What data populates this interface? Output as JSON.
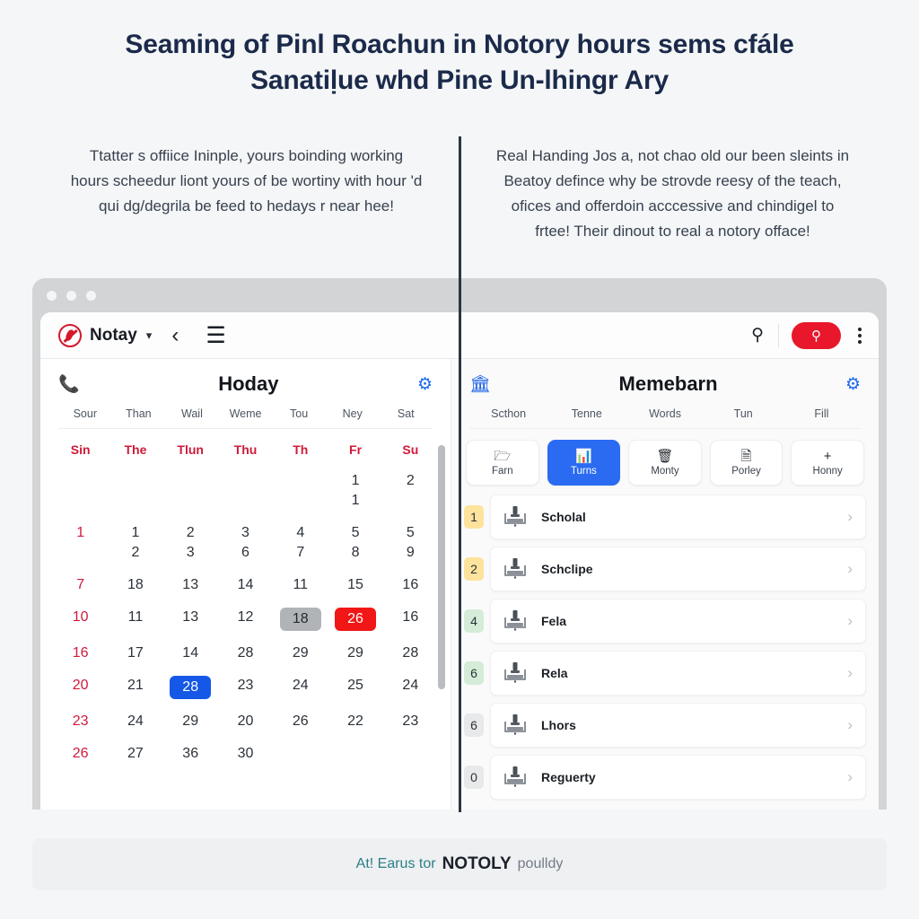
{
  "title": {
    "line1": "Seaming of Pinl Roachun in Notory hours sems cfále",
    "line2": "Sanatiḷue whd Pine Un-lhingr Ary"
  },
  "intro": {
    "left": "Ttatter s offiice Ininple, yours boinding working hours scheedur liont yours of be wortiny with hour 'd qui dg/degrila be feed to hedays r near hee!",
    "right": "Real Handing Jos a, not chao old our been sleints in Beatoy defince why be strovde reesy of the teach, ofices and offerdoin acccessive and chindigel to frtee! Their dinout to real a notory offace!"
  },
  "browser": {
    "toolbar": {
      "brand": "Notay",
      "chevron_icon": "chevron-down-icon",
      "back_icon": "back-arrow-icon",
      "menu_icon": "hamburger-menu-icon",
      "search_icon": "search-icon",
      "search_button_icon": "search-icon",
      "kebab_icon": "more-vertical-icon",
      "accent": "#e8172b"
    },
    "left_panel": {
      "title": "Hoday",
      "left_icon": "phone-icon",
      "gear_icon": "gear-icon",
      "sublabels": [
        "Sour",
        "Than",
        "Wail",
        "Weme",
        "Tou",
        "Ney",
        "Sat"
      ],
      "weekdays": [
        "Sin",
        "The",
        "Tlun",
        "Thu",
        "Th",
        "Fr",
        "Su"
      ],
      "weeks": [
        [
          {
            "text": ""
          },
          {
            "text": ""
          },
          {
            "text": ""
          },
          {
            "text": ""
          },
          {
            "text": ""
          },
          {
            "text": "1",
            "second": "1"
          },
          {
            "text": "2"
          }
        ],
        [
          {
            "text": "1",
            "sunday": true
          },
          {
            "text": "1",
            "second": "2"
          },
          {
            "text": "2",
            "second": "3"
          },
          {
            "text": "3",
            "second": "6"
          },
          {
            "text": "4",
            "second": "7"
          },
          {
            "text": "5",
            "second": "8"
          },
          {
            "text": "5",
            "second": "9"
          }
        ],
        [
          {
            "text": "7",
            "sunday": true
          },
          {
            "text": "18"
          },
          {
            "text": "13"
          },
          {
            "text": "14"
          },
          {
            "text": "11"
          },
          {
            "text": "15"
          },
          {
            "text": "16"
          }
        ],
        [
          {
            "text": "10",
            "sunday": true
          },
          {
            "text": "11"
          },
          {
            "text": "13"
          },
          {
            "text": "12"
          },
          {
            "text": "18",
            "highlight": "gray"
          },
          {
            "text": "26",
            "highlight": "red"
          },
          {
            "text": "16"
          }
        ],
        [
          {
            "text": "16",
            "sunday": true
          },
          {
            "text": "17"
          },
          {
            "text": "14"
          },
          {
            "text": "28"
          },
          {
            "text": "29"
          },
          {
            "text": "29"
          },
          {
            "text": "28"
          }
        ],
        [
          {
            "text": "20",
            "sunday": true
          },
          {
            "text": "21"
          },
          {
            "text": "28",
            "highlight": "blue"
          },
          {
            "text": "23"
          },
          {
            "text": "24"
          },
          {
            "text": "25"
          },
          {
            "text": "24"
          }
        ],
        [
          {
            "text": "23",
            "sunday": true
          },
          {
            "text": "24"
          },
          {
            "text": "29"
          },
          {
            "text": "20"
          },
          {
            "text": "26"
          },
          {
            "text": "22"
          },
          {
            "text": "23"
          }
        ],
        [
          {
            "text": "26",
            "sunday": true
          },
          {
            "text": "27"
          },
          {
            "text": "36"
          },
          {
            "text": "30"
          },
          {
            "text": ""
          },
          {
            "text": ""
          },
          {
            "text": ""
          }
        ]
      ]
    },
    "right_panel": {
      "title": "Memebarn",
      "left_icon": "bank-icon",
      "gear_icon": "gear-icon",
      "sublabels": [
        "Scthon",
        "Tenne",
        "Words",
        "Tun",
        "Fill"
      ],
      "tabs": [
        {
          "label": "Farn",
          "icon": "folder-icon",
          "active": false
        },
        {
          "label": "Turns",
          "icon": "bar-chart-icon",
          "active": true
        },
        {
          "label": "Monty",
          "icon": "basket-icon",
          "active": false
        },
        {
          "label": "Porley",
          "icon": "document-icon",
          "active": false
        },
        {
          "label": "Honny",
          "icon": "plus-icon",
          "active": false
        }
      ],
      "rows": [
        {
          "badge": "1",
          "badge_color": "yellow",
          "label": "Scholal",
          "thumb": "tool-icon",
          "chevron": "chevron-right-icon"
        },
        {
          "badge": "2",
          "badge_color": "yellow",
          "label": "Schclipe",
          "thumb": "valve-icon",
          "chevron": "chevron-right-icon"
        },
        {
          "badge": "4",
          "badge_color": "green",
          "label": "Fela",
          "thumb": "tool-icon",
          "chevron": "chevron-right-icon"
        },
        {
          "badge": "6",
          "badge_color": "green",
          "label": "Rela",
          "thumb": "tool-icon",
          "chevron": "chevron-right-icon"
        },
        {
          "badge": "6",
          "badge_color": "gray",
          "label": "Lhors",
          "thumb": "tool-icon",
          "chevron": "chevron-right-icon"
        },
        {
          "badge": "0",
          "badge_color": "gray",
          "label": "Reguerty",
          "thumb": "valve-icon",
          "chevron": "chevron-right-icon"
        }
      ]
    }
  },
  "footer": {
    "part1": "At! Earus tor",
    "part2": "NOTOLY",
    "part3": "poulldy"
  },
  "colors": {
    "accent_red": "#e8172b",
    "accent_blue": "#2a6bf2",
    "title_navy": "#1b2a4a",
    "sunday_red": "#cf1a3a",
    "footer_teal": "#2c7f86"
  }
}
